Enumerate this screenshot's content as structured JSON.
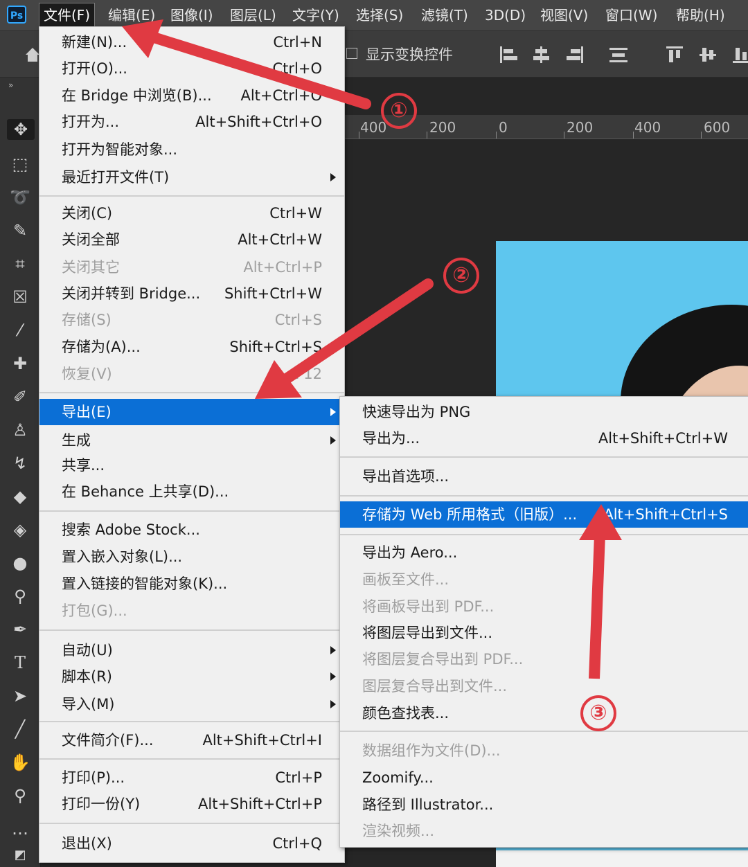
{
  "app": {
    "logo": "Ps"
  },
  "menubar": {
    "items": [
      "文件(F)",
      "编辑(E)",
      "图像(I)",
      "图层(L)",
      "文字(Y)",
      "选择(S)",
      "滤镜(T)",
      "3D(D)",
      "视图(V)",
      "窗口(W)",
      "帮助(H)"
    ]
  },
  "options_bar": {
    "show_transform_controls": "显示变换控件"
  },
  "ruler": {
    "labels": [
      "400",
      "200",
      "0",
      "200",
      "400",
      "600"
    ]
  },
  "file_menu": {
    "items": [
      {
        "label": "新建(N)...",
        "shortcut": "Ctrl+N"
      },
      {
        "label": "打开(O)...",
        "shortcut": "Ctrl+O"
      },
      {
        "label": "在 Bridge 中浏览(B)...",
        "shortcut": "Alt+Ctrl+O"
      },
      {
        "label": "打开为...",
        "shortcut": "Alt+Shift+Ctrl+O"
      },
      {
        "label": "打开为智能对象...",
        "shortcut": ""
      },
      {
        "label": "最近打开文件(T)",
        "shortcut": ""
      },
      {
        "label": "关闭(C)",
        "shortcut": "Ctrl+W"
      },
      {
        "label": "关闭全部",
        "shortcut": "Alt+Ctrl+W"
      },
      {
        "label": "关闭其它",
        "shortcut": "Alt+Ctrl+P"
      },
      {
        "label": "关闭并转到 Bridge...",
        "shortcut": "Shift+Ctrl+W"
      },
      {
        "label": "存储(S)",
        "shortcut": "Ctrl+S"
      },
      {
        "label": "存储为(A)...",
        "shortcut": "Shift+Ctrl+S"
      },
      {
        "label": "恢复(V)",
        "shortcut": "F12"
      },
      {
        "label": "导出(E)",
        "shortcut": ""
      },
      {
        "label": "生成",
        "shortcut": ""
      },
      {
        "label": "共享...",
        "shortcut": ""
      },
      {
        "label": "在 Behance 上共享(D)...",
        "shortcut": ""
      },
      {
        "label": "搜索 Adobe Stock...",
        "shortcut": ""
      },
      {
        "label": "置入嵌入对象(L)...",
        "shortcut": ""
      },
      {
        "label": "置入链接的智能对象(K)...",
        "shortcut": ""
      },
      {
        "label": "打包(G)...",
        "shortcut": ""
      },
      {
        "label": "自动(U)",
        "shortcut": ""
      },
      {
        "label": "脚本(R)",
        "shortcut": ""
      },
      {
        "label": "导入(M)",
        "shortcut": ""
      },
      {
        "label": "文件简介(F)...",
        "shortcut": "Alt+Shift+Ctrl+I"
      },
      {
        "label": "打印(P)...",
        "shortcut": "Ctrl+P"
      },
      {
        "label": "打印一份(Y)",
        "shortcut": "Alt+Shift+Ctrl+P"
      },
      {
        "label": "退出(X)",
        "shortcut": "Ctrl+Q"
      }
    ]
  },
  "export_submenu": {
    "items": [
      {
        "label": "快速导出为 PNG",
        "shortcut": ""
      },
      {
        "label": "导出为...",
        "shortcut": "Alt+Shift+Ctrl+W"
      },
      {
        "label": "导出首选项...",
        "shortcut": ""
      },
      {
        "label": "存储为 Web 所用格式（旧版）...",
        "shortcut": "Alt+Shift+Ctrl+S"
      },
      {
        "label": "导出为 Aero...",
        "shortcut": ""
      },
      {
        "label": "画板至文件...",
        "shortcut": ""
      },
      {
        "label": "将画板导出到 PDF...",
        "shortcut": ""
      },
      {
        "label": "将图层导出到文件...",
        "shortcut": ""
      },
      {
        "label": "将图层复合导出到 PDF...",
        "shortcut": ""
      },
      {
        "label": "图层复合导出到文件...",
        "shortcut": ""
      },
      {
        "label": "颜色查找表...",
        "shortcut": ""
      },
      {
        "label": "数据组作为文件(D)...",
        "shortcut": ""
      },
      {
        "label": "Zoomify...",
        "shortcut": ""
      },
      {
        "label": "路径到 Illustrator...",
        "shortcut": ""
      },
      {
        "label": "渲染视频...",
        "shortcut": ""
      }
    ]
  },
  "annotations": {
    "step1": "①",
    "step2": "②",
    "step3": "③",
    "color": "#e03a42"
  },
  "colors": {
    "highlight": "#0b6fd6",
    "menu_bg": "#f0f0f0",
    "canvas_bg": "#5ec6ee"
  }
}
